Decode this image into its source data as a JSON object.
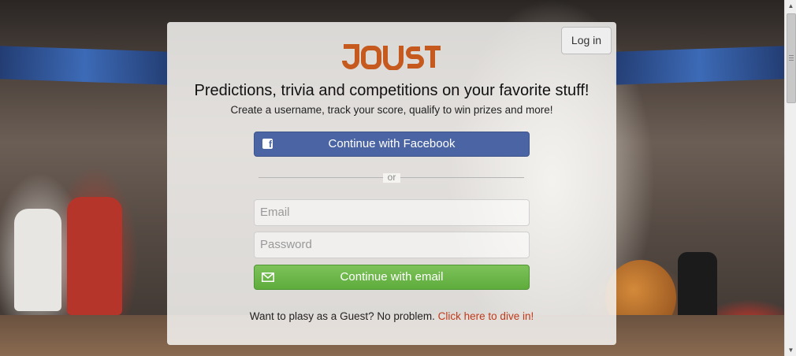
{
  "header": {
    "login_label": "Log in"
  },
  "brand": {
    "logo_text": "JOUST",
    "logo_color": "#c65a1e"
  },
  "hero": {
    "headline": "Predictions, trivia and competitions on your favorite stuff!",
    "subline": "Create a username, track your score, qualify to win prizes and more!"
  },
  "auth": {
    "facebook_label": "Continue with Facebook",
    "facebook_icon": "facebook-icon",
    "divider_text": "or",
    "email_placeholder": "Email",
    "password_placeholder": "Password",
    "email_button_label": "Continue with email",
    "email_icon": "envelope-icon"
  },
  "guest": {
    "prompt": "Want to plasy as a Guest? No problem.",
    "link_label": "Click here to dive in!"
  },
  "colors": {
    "facebook": "#4a64a4",
    "email_button": "#5eac3c",
    "link": "#c0391b"
  }
}
